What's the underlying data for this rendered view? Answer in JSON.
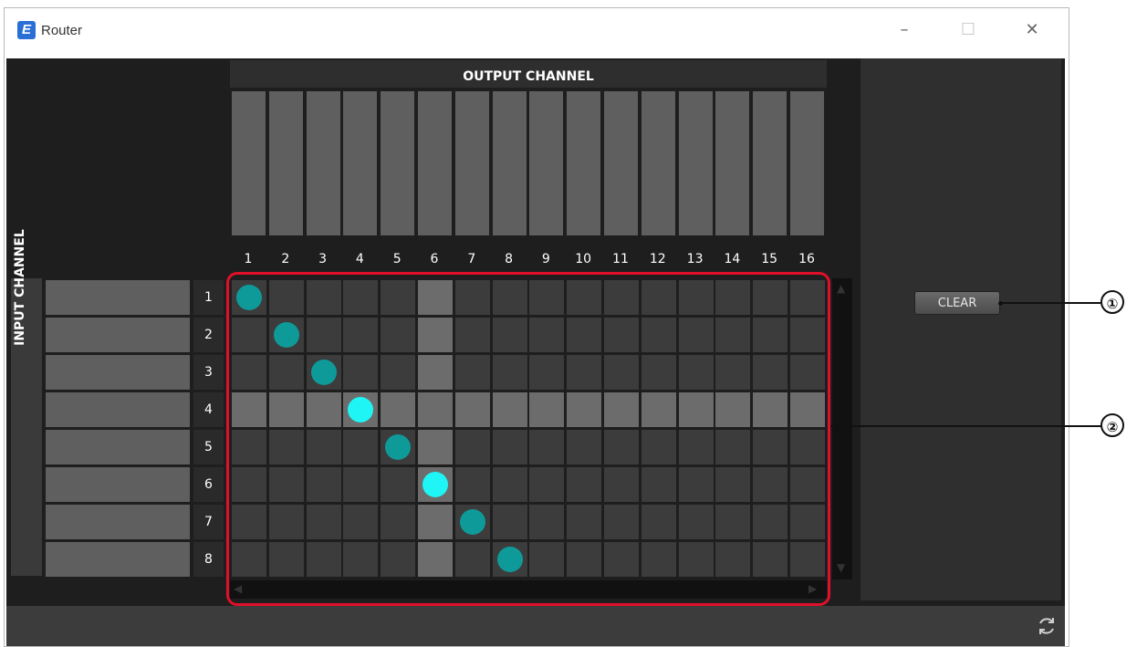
{
  "window": {
    "title": "Router",
    "minimize_glyph": "–",
    "maximize_glyph": "☐",
    "close_glyph": "✕"
  },
  "output": {
    "label": "OUTPUT CHANNEL",
    "channels": [
      "1",
      "2",
      "3",
      "4",
      "5",
      "6",
      "7",
      "8",
      "9",
      "10",
      "11",
      "12",
      "13",
      "14",
      "15",
      "16"
    ]
  },
  "input": {
    "label": "INPUT CHANNEL",
    "channels": [
      "1",
      "2",
      "3",
      "4",
      "5",
      "6",
      "7",
      "8"
    ]
  },
  "routing": {
    "selected_input": 4,
    "selected_output": 6,
    "connections": [
      {
        "input": 1,
        "output": 1,
        "state": "on"
      },
      {
        "input": 2,
        "output": 2,
        "state": "on"
      },
      {
        "input": 3,
        "output": 3,
        "state": "on"
      },
      {
        "input": 4,
        "output": 4,
        "state": "active"
      },
      {
        "input": 5,
        "output": 5,
        "state": "on"
      },
      {
        "input": 6,
        "output": 6,
        "state": "active"
      },
      {
        "input": 7,
        "output": 7,
        "state": "on"
      },
      {
        "input": 8,
        "output": 8,
        "state": "on"
      }
    ]
  },
  "controls": {
    "clear_label": "CLEAR"
  },
  "callouts": {
    "first": "①",
    "second": "②"
  },
  "colors": {
    "dot_on": "#0f9a9a",
    "dot_active": "#1ff5f5",
    "highlight_cell": "#6c6c6c",
    "callout_frame": "#e0102a"
  }
}
